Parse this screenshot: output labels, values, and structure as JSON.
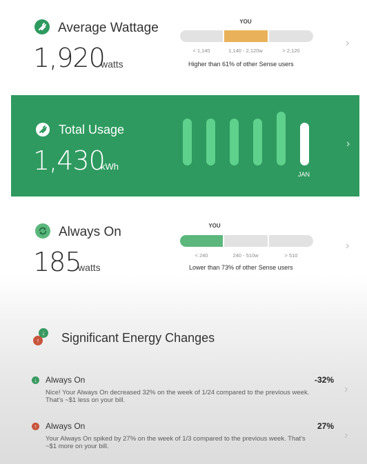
{
  "average_wattage": {
    "title": "Average Wattage",
    "value": "1,920",
    "unit": "watts",
    "you_label": "YOU",
    "segments": [
      "< 1,140",
      "1,140 - 2,120w",
      "> 2,120"
    ],
    "highlight_index": 1,
    "comparison": "Higher than 61% of other Sense users",
    "accent_color": "#e9b25a",
    "icon": "plug-icon"
  },
  "total_usage": {
    "title": "Total Usage",
    "value": "1,430",
    "unit": "kWh",
    "current_month_label": "JAN",
    "panel_color": "#2e9a5f",
    "bar_color": "#5ed18d",
    "icon": "plug-icon"
  },
  "always_on": {
    "title": "Always On",
    "value": "185",
    "unit": "watts",
    "you_label": "YOU",
    "segments": [
      "< 240",
      "240 - 510w",
      "> 510"
    ],
    "highlight_index": 0,
    "comparison": "Lower than 73% of other Sense users",
    "accent_color": "#5bb77c",
    "icon": "refresh-icon"
  },
  "energy_changes": {
    "title": "Significant Energy Changes",
    "items": [
      {
        "title": "Always On",
        "percent": "-32%",
        "description": "Nice! Your Always On decreased 32% on the week of 1/24 compared to the previous week. That's ~$1 less on your bill.",
        "direction": "down",
        "color": "#3a9a62"
      },
      {
        "title": "Always On",
        "percent": "27%",
        "description": "Your Always On spiked by 27% on the week of 1/3 compared to the previous week. That's ~$1 more on your bill.",
        "direction": "up",
        "color": "#c8553d"
      }
    ]
  }
}
